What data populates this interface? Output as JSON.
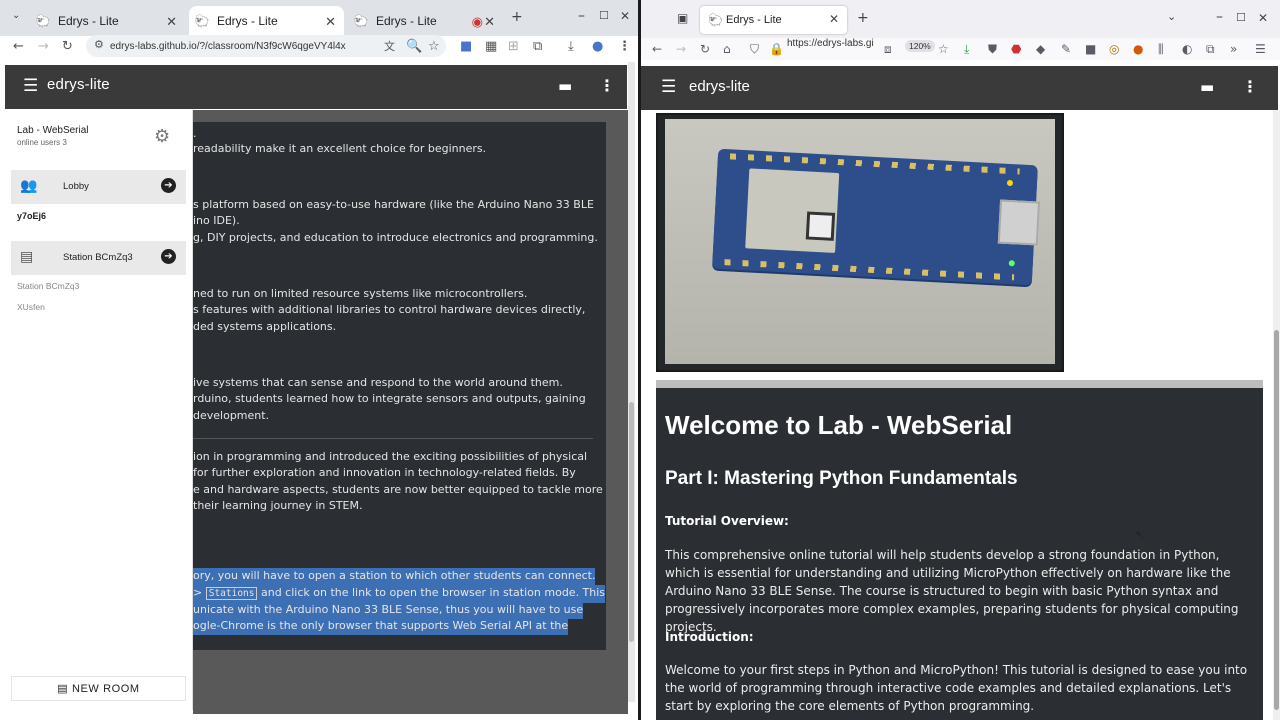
{
  "left_browser": {
    "tabs": [
      {
        "title": "Edrys - Lite"
      },
      {
        "title": "Edrys - Lite"
      },
      {
        "title": "Edrys - Lite"
      }
    ],
    "url": "edrys-labs.github.io/?/classroom/N3f9cW6qgeVY4l4x"
  },
  "right_browser": {
    "tab_title": "Edrys - Lite",
    "url": "https://edrys-labs.gi",
    "zoom": "120%"
  },
  "app": {
    "name": "edrys-lite"
  },
  "sidebar": {
    "lab_title": "Lab - WebSerial",
    "online_users": "online users 3",
    "rooms": [
      {
        "label": "Lobby"
      },
      {
        "label": "Station BCmZq3"
      }
    ],
    "lobby_users": [
      "y7oEj6"
    ],
    "station_users": [
      "Station BCmZq3",
      "XUsfen"
    ],
    "new_room_label": "NEW ROOM"
  },
  "left_doc": {
    "lines": [
      ".",
      "readability make it an excellent choice for beginners.",
      "s platform based on easy-to-use hardware (like the Arduino Nano 33 BLE",
      "ino IDE).",
      "g, DIY projects, and education to introduce electronics and programming.",
      "ned to run on limited resource systems like microcontrollers.",
      "s features with additional libraries to control hardware devices directly,",
      "ded systems applications.",
      "ive systems that can sense and respond to the world around them.",
      "rduino, students learned how to integrate sensors and outputs, gaining",
      " development.",
      "ion in programming and introduced the exciting possibilities of physical",
      "for further exploration and innovation in technology-related fields. By",
      "e and hardware aspects, students are now better equipped to tackle more",
      "their learning journey in STEM."
    ],
    "selected_lines": [
      "ory, you will have to open a station to which other students can connect.",
      "and click on the link to open the browser in station mode. This",
      "unicate with the Arduino Nano 33 BLE Sense, thus you will have to use",
      "ogle-Chrome is the only browser that supports Web Serial API at the"
    ],
    "selected_code": "Stations"
  },
  "right_doc": {
    "h1": "Welcome to Lab - WebSerial",
    "h2": "Part I: Mastering Python Fundamentals",
    "tutorial_heading": "Tutorial Overview:",
    "tutorial_text": "This comprehensive online tutorial will help students develop a strong foundation in Python, which is essential for understanding and utilizing MicroPython effectively on hardware like the Arduino Nano 33 BLE Sense. The course is structured to begin with basic Python syntax and progressively incorporates more complex examples, preparing students for physical computing projects.",
    "intro_heading": "Introduction:",
    "intro_text": "Welcome to your first steps in Python and MicroPython! This tutorial is designed to ease you into the world of programming through interactive code examples and detailed explanations. Let's start by exploring the core elements of Python programming."
  },
  "colors": {
    "app_bar": "#3a3a3a",
    "content_dark": "#2b2f33",
    "selection": "#3d6fb4"
  }
}
